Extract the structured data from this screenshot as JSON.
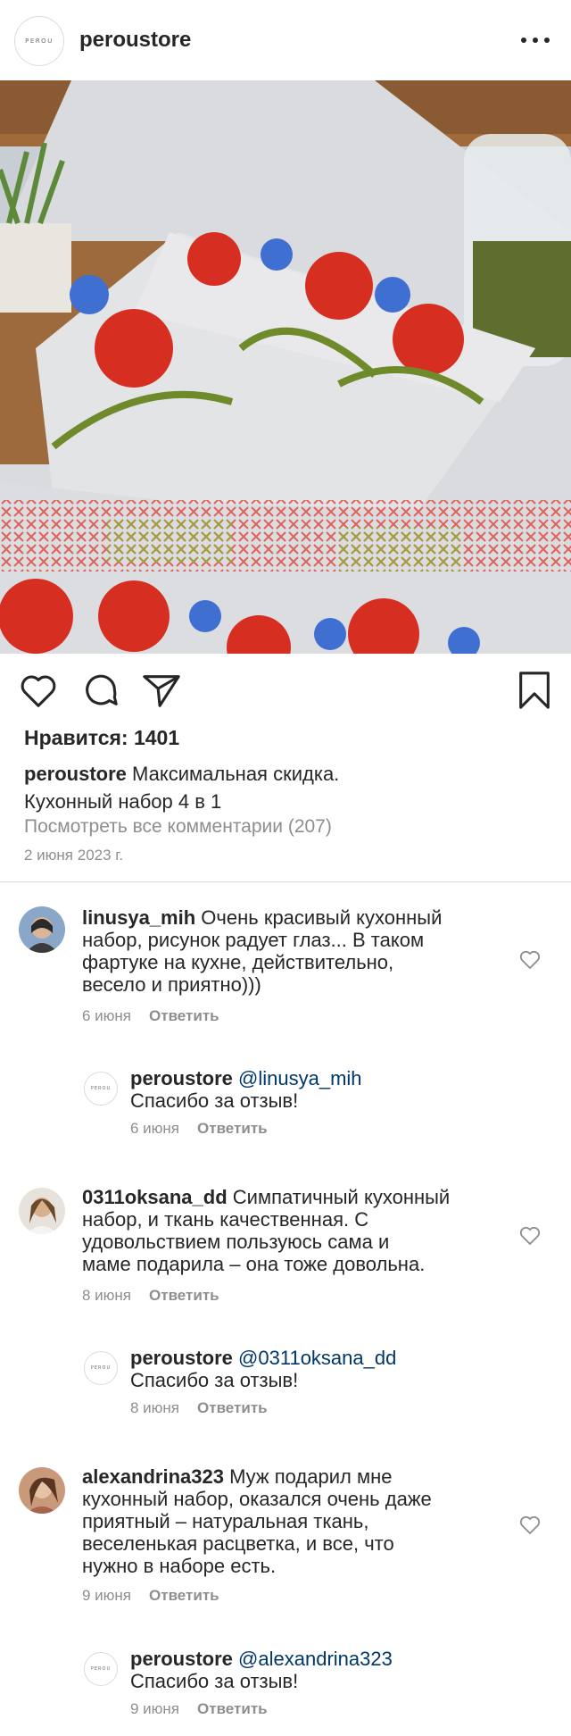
{
  "header": {
    "username": "peroustore",
    "logo_text": "PEROU",
    "more_icon": "more-horizontal-icon"
  },
  "post": {
    "image_alt": "Кухонный набор с маками",
    "actions": {
      "like_icon": "heart-icon",
      "comment_icon": "comment-icon",
      "share_icon": "paper-plane-icon",
      "save_icon": "bookmark-icon"
    },
    "likes_text": "Нравится: 1401",
    "caption": {
      "author": "peroustore",
      "line1": "Максимальная скидка.",
      "line2": "Кухонный набор 4 в 1"
    },
    "view_all_comments": "Посмотреть все комментарии (207)",
    "date": "2 июня 2023 г."
  },
  "comments": [
    {
      "author": "linusya_mih",
      "text_lines": [
        "Очень красивый кухонный",
        "набор, рисунок радует глаз... В таком",
        "фартуке на кухне, действительно,",
        "весело и приятно)))"
      ],
      "date": "6 июня",
      "reply_label": "Ответить",
      "reply": {
        "author": "peroustore",
        "mention": "@linusya_mih",
        "text": "Спасибо за отзыв!",
        "date": "6 июня",
        "reply_label": "Ответить"
      }
    },
    {
      "author": "0311oksana_dd",
      "text_lines": [
        "Симпатичный кухонный",
        "набор, и ткань качественная. С",
        "удовольствием пользуюсь сама и",
        "маме подарила – она тоже довольна."
      ],
      "date": "8 июня",
      "reply_label": "Ответить",
      "reply": {
        "author": "peroustore",
        "mention": "@0311oksana_dd",
        "text": "Спасибо за отзыв!",
        "date": "8 июня",
        "reply_label": "Ответить"
      }
    },
    {
      "author": "alexandrina323",
      "text_lines": [
        "Муж подарил мне",
        "кухонный набор, оказался очень даже",
        "приятный – натуральная ткань,",
        "веселенькая расцветка, и все, что",
        "нужно в наборе есть."
      ],
      "date": "9 июня",
      "reply_label": "Ответить",
      "reply": {
        "author": "peroustore",
        "mention": "@alexandrina323",
        "text": "Спасибо за отзыв!",
        "date": "9 июня",
        "reply_label": "Ответить"
      }
    }
  ],
  "colors": {
    "text": "#262626",
    "muted": "#8e8e8e",
    "mention": "#00376b",
    "divider": "#dbdbdb"
  }
}
